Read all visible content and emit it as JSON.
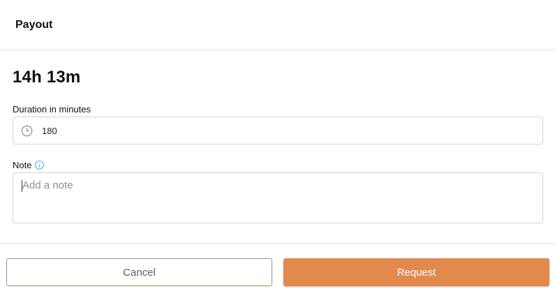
{
  "header": {
    "title": "Payout"
  },
  "balance": {
    "value": "14h 13m"
  },
  "duration": {
    "label": "Duration in minutes",
    "icon": "clock-icon",
    "value": "180"
  },
  "note": {
    "label": "Note",
    "info_icon": "info-icon",
    "placeholder": "Add a note",
    "value": ""
  },
  "actions": {
    "cancel_label": "Cancel",
    "request_label": "Request"
  },
  "colors": {
    "accent": "#e2894d",
    "info": "#4a9fd8",
    "icon_muted": "#8a99ad"
  }
}
